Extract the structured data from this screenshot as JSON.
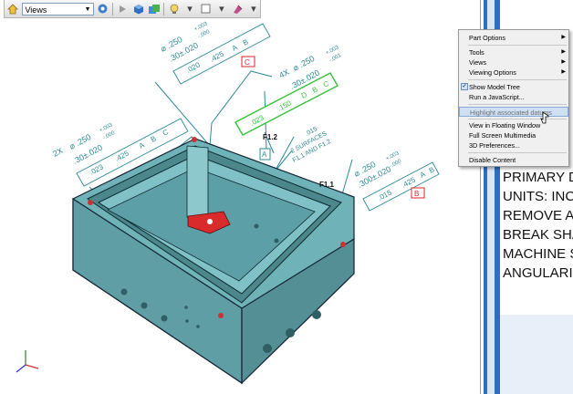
{
  "toolbar": {
    "views_label": "Views",
    "home_icon": "home-icon",
    "tree_icon": "model-tree-icon",
    "play_icon": "play-icon",
    "cube_icon": "cube-icon",
    "render_icon": "render-mode-icon",
    "light_icon": "lighting-icon",
    "bg_icon": "background-color-icon",
    "crosssection_icon": "cross-section-icon"
  },
  "model": {
    "annotations": {
      "left_qty": "2X",
      "left_dia": "⌀ .250",
      "left_tol_plus": "+.003",
      "left_tol_minus": "-.000",
      "left_depth": ".30±.020",
      "left_fcf": [
        ".023",
        "Ⓟ",
        ".425",
        "A",
        "B",
        "C"
      ],
      "top_dia": "⌀ .250",
      "top_tol_plus": "+.003",
      "top_tol_minus": "-.000",
      "top_depth": ".30±.020",
      "top_fcf": [
        ".020",
        "Ⓟ",
        ".425",
        "A",
        "B"
      ],
      "top_datum": "C",
      "mid_qty": "4X",
      "mid_dia": "⌀ .250",
      "mid_tol_plus": "+.003",
      "mid_tol_minus": "-.001",
      "mid_depth": ".30±.020",
      "mid_fcf": [
        ".023",
        "Ⓟ",
        ".150",
        "D",
        "B",
        "C"
      ],
      "flat_tol": ".015",
      "datum_a": "A",
      "surfaces_line1": "2 SURFACES",
      "surfaces_line2": "F1.1 AND F1.2",
      "f12": "F1.2",
      "f11": "F1.1",
      "right_dia": "⌀ .250",
      "right_tol_plus": "+.003",
      "right_tol_minus": "-.000",
      "right_depth": ".300±.020",
      "right_fcf": [
        ".015",
        "Ⓟ",
        ".425",
        "A",
        "B"
      ],
      "right_datum": "B"
    }
  },
  "context_menu": {
    "items": [
      {
        "label": "Part Options",
        "submenu": true
      },
      {
        "label": "Tools",
        "submenu": true
      },
      {
        "label": "Views",
        "submenu": true
      },
      {
        "label": "Viewing Options",
        "submenu": true
      },
      {
        "label": "Show Model Tree",
        "checked": true
      },
      {
        "label": "Run a JavaScript..."
      },
      {
        "label": "Highlight associated datums",
        "highlighted": true
      },
      {
        "label": "View in Floating Window"
      },
      {
        "label": "Full Screen Multimedia"
      },
      {
        "label": "3D Preferences..."
      },
      {
        "label": "Disable Content"
      }
    ]
  },
  "document": {
    "lines": [
      "PRIMARY D",
      "UNITS: INCI",
      "REMOVE AL",
      "BREAK SHA",
      "MACHINE S",
      "ANGULARIT"
    ]
  },
  "colors": {
    "model_body": "#6fb3b8",
    "annotation": "#2d8a96",
    "annotation_highlight": "#33c23a",
    "datum_red": "#d9262b",
    "menu_highlight": "#cfe0f5"
  }
}
